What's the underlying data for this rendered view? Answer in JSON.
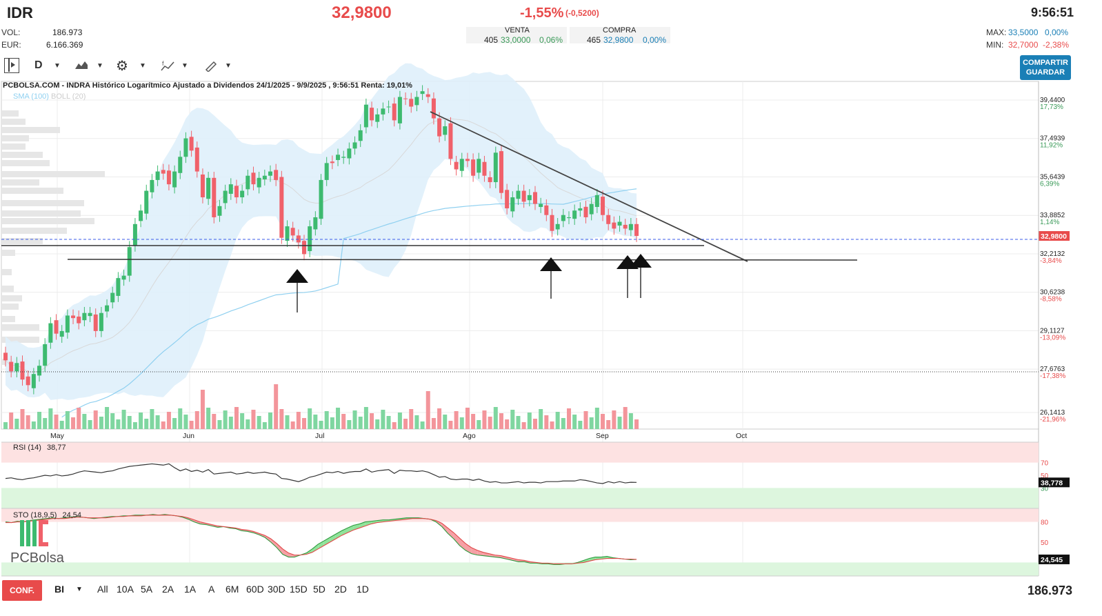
{
  "header": {
    "ticker": "IDR",
    "price": "32,9800",
    "change_pct": "-1,55%",
    "change_abs": "(-0,5200)",
    "time": "9:56:51",
    "vol_label": "VOL:",
    "vol_value": "186.973",
    "eur_label": "EUR:",
    "eur_value": "6.166.369",
    "venta_label": "VENTA",
    "venta_qty": "405",
    "venta_price": "33,0000",
    "venta_pct": "0,06%",
    "compra_label": "COMPRA",
    "compra_qty": "465",
    "compra_price": "32,9800",
    "compra_pct": "0,00%",
    "max_label": "MAX:",
    "max_value": "33,5000",
    "max_pct": "0,00%",
    "min_label": "MIN:",
    "min_value": "32,7000",
    "min_pct": "-2,38%"
  },
  "toolbar": {
    "period": "D",
    "share_line1": "COMPARTIR",
    "share_line2": "GUARDAR"
  },
  "bottom": {
    "config_label": "CONF.",
    "mode": "BI",
    "ranges": [
      "All",
      "10A",
      "5A",
      "2A",
      "1A",
      "A",
      "6M",
      "60D",
      "30D",
      "15D",
      "5D",
      "2D",
      "1D"
    ],
    "volume": "186.973",
    "logo": "PCBolsa"
  },
  "colors": {
    "up": "#3dba6f",
    "down": "#f0616a",
    "band": "#dff0fb",
    "sma": "#8fd0f0",
    "brand_red": "#e84b4b",
    "brand_blue": "#1a7fb6"
  },
  "chart_data": [
    {
      "type": "candlestick",
      "title": "PCBOLSA.COM - INDRA Histórico Logarítmico Ajustado a Dividendos 24/1/2025 - 9/9/2025 , 9:56:51 Renta: 19,01%",
      "indicators_legend": [
        "SMA (100)",
        "BOLL (20)"
      ],
      "x_tick_labels": [
        "May",
        "Jun",
        "Jul",
        "Ago",
        "Sep",
        "Oct"
      ],
      "y_ticks": [
        {
          "value": "39,4400",
          "pct": "17,73%"
        },
        {
          "value": "37,4939",
          "pct": "11,92%"
        },
        {
          "value": "35,6439",
          "pct": "6,39%"
        },
        {
          "value": "33,8852",
          "pct": "1,14%"
        },
        {
          "value": "32,2132",
          "pct": "-3,84%"
        },
        {
          "value": "30,6238",
          "pct": "-8,58%"
        },
        {
          "value": "29,1127",
          "pct": "-13,09%"
        },
        {
          "value": "27,6763",
          "pct": "-17,38%"
        },
        {
          "value": "26,1413",
          "pct": "-21,96%"
        }
      ],
      "last_price_label": "32,9800",
      "y_scale": "log",
      "close": [
        28.0,
        27.6,
        27.9,
        27.3,
        27.1,
        27.5,
        27.8,
        28.6,
        29.4,
        29.0,
        29.1,
        29.7,
        29.6,
        29.4,
        29.8,
        29.8,
        29.1,
        29.8,
        30.1,
        30.6,
        31.2,
        31.3,
        32.5,
        33.5,
        34.1,
        35.0,
        35.5,
        35.9,
        35.8,
        35.3,
        35.9,
        36.6,
        37.5,
        36.9,
        35.9,
        34.7,
        35.6,
        33.8,
        34.3,
        35.0,
        35.3,
        34.7,
        35.0,
        35.7,
        35.3,
        35.6,
        35.7,
        35.9,
        35.5,
        32.9,
        33.4,
        33.0,
        32.7,
        32.2,
        33.4,
        33.8,
        35.5,
        36.3,
        36.3,
        36.7,
        36.6,
        37.0,
        37.3,
        37.9,
        39.2,
        38.4,
        38.7,
        39.0,
        39.1,
        38.4,
        39.6,
        39.5,
        39.1,
        39.6,
        39.9,
        39.6,
        38.5,
        37.6,
        38.1,
        36.5,
        36.0,
        36.5,
        36.4,
        35.7,
        36.5,
        35.7,
        35.4,
        36.8,
        34.9,
        34.2,
        34.7,
        35.0,
        34.5,
        34.8,
        34.4,
        34.4,
        33.9,
        33.2,
        33.5,
        33.9,
        33.8,
        34.1,
        34.2,
        33.8,
        34.4,
        34.8,
        33.9,
        33.5,
        33.3,
        33.6,
        33.3,
        33.5,
        32.98
      ],
      "volume_note": "volume bars shown beneath price, colored by candle direction",
      "resistance_line": "descending trendline from July highs",
      "support_lines": 2,
      "arrows": 4
    },
    {
      "type": "line",
      "title": "RSI (14)",
      "value_label": "38,77",
      "last_label": "38,778",
      "y_ticks": [
        "70",
        "50",
        "30"
      ],
      "series": [
        {
          "values": [
            45,
            46,
            44,
            43,
            45,
            46,
            48,
            50,
            49,
            51,
            49,
            50,
            52,
            55,
            57,
            56,
            55,
            54,
            56,
            57,
            60,
            62,
            64,
            65,
            66,
            67,
            68,
            67,
            66,
            68,
            62,
            57,
            60,
            56,
            58,
            55,
            59,
            52,
            53,
            54,
            55,
            52,
            53,
            55,
            53,
            54,
            55,
            53,
            52,
            45,
            44,
            42,
            40,
            43,
            47,
            49,
            52,
            55,
            54,
            56,
            53,
            55,
            56,
            56,
            60,
            55,
            57,
            58,
            59,
            53,
            58,
            57,
            57,
            56,
            57,
            55,
            51,
            47,
            48,
            44,
            43,
            44,
            44,
            42,
            44,
            41,
            39,
            40,
            38,
            38,
            39,
            40,
            38,
            39,
            39,
            38,
            40,
            40,
            40,
            41,
            41,
            41,
            43,
            42,
            40,
            38,
            37,
            40,
            38,
            40,
            38,
            39,
            38.77
          ]
        }
      ]
    },
    {
      "type": "line",
      "title": "STO (18,9,5)",
      "value_label": "24,54",
      "last_label": "24,545",
      "y_ticks": [
        "80",
        "50"
      ],
      "series": [
        {
          "values": [
            80,
            79,
            81,
            80,
            82,
            83,
            84,
            85,
            86,
            85,
            86,
            87,
            88,
            87,
            86,
            85,
            86,
            87,
            88,
            88,
            89,
            89,
            90,
            90,
            90,
            91,
            90,
            91,
            90,
            89,
            87,
            84,
            80,
            77,
            76,
            74,
            72,
            73,
            71,
            70,
            67,
            66,
            64,
            61,
            57,
            50,
            42,
            32,
            28,
            28,
            31,
            34,
            40,
            47,
            52,
            57,
            62,
            67,
            71,
            75,
            77,
            80,
            81,
            82,
            83,
            83,
            84,
            85,
            86,
            86,
            86,
            85,
            84,
            80,
            73,
            63,
            55,
            45,
            38,
            33,
            31,
            30,
            29,
            28,
            27,
            25,
            23,
            21,
            21,
            19,
            19,
            18,
            18,
            17,
            17,
            18,
            18,
            20,
            23,
            26,
            28,
            28,
            29,
            27,
            26,
            25,
            24,
            24.54
          ]
        },
        {
          "values": [
            79,
            79,
            80,
            80,
            81,
            82,
            83,
            84,
            85,
            85,
            85,
            86,
            87,
            87,
            86,
            86,
            86,
            86,
            87,
            88,
            88,
            89,
            89,
            89,
            90,
            90,
            90,
            90,
            90,
            89,
            88,
            86,
            83,
            80,
            78,
            76,
            74,
            73,
            72,
            71,
            69,
            68,
            66,
            63,
            60,
            55,
            48,
            40,
            34,
            31,
            31,
            32,
            35,
            40,
            45,
            50,
            55,
            60,
            64,
            68,
            71,
            74,
            77,
            79,
            80,
            81,
            82,
            83,
            84,
            85,
            85,
            85,
            84,
            82,
            78,
            71,
            64,
            56,
            48,
            42,
            38,
            35,
            33,
            31,
            30,
            28,
            26,
            24,
            23,
            21,
            20,
            19,
            19,
            18,
            18,
            18,
            18,
            19,
            20,
            22,
            24,
            25,
            26,
            26,
            26,
            25,
            25,
            24.6
          ]
        }
      ]
    }
  ]
}
